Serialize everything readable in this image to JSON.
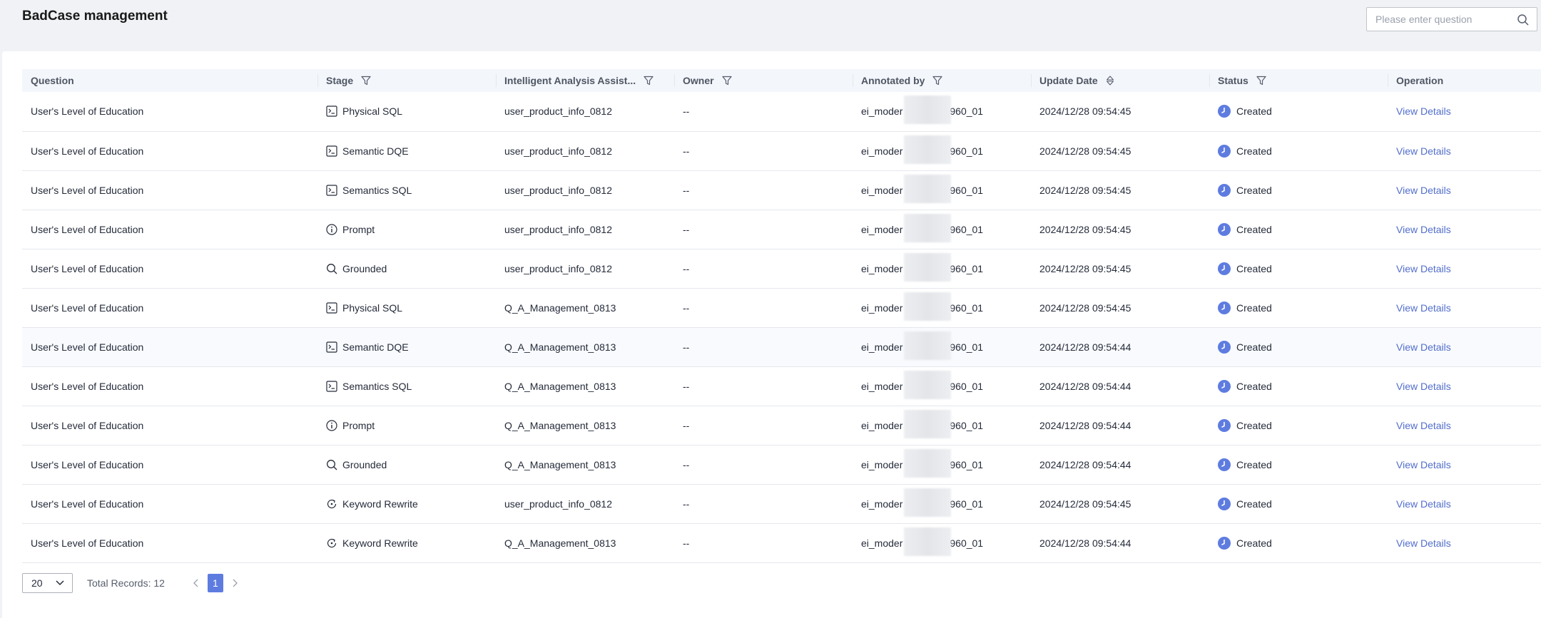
{
  "header": {
    "title": "BadCase management",
    "search_placeholder": "Please enter question"
  },
  "table": {
    "columns": [
      {
        "label": "Question",
        "filter": false,
        "sort": false
      },
      {
        "label": "Stage",
        "filter": true,
        "sort": false
      },
      {
        "label": "Intelligent Analysis Assist...",
        "filter": true,
        "sort": false
      },
      {
        "label": "Owner",
        "filter": true,
        "sort": false
      },
      {
        "label": "Annotated by",
        "filter": true,
        "sort": false
      },
      {
        "label": "Update Date",
        "filter": false,
        "sort": true
      },
      {
        "label": "Status",
        "filter": true,
        "sort": false
      },
      {
        "label": "Operation",
        "filter": false,
        "sort": false
      }
    ],
    "rows": [
      {
        "question": "User's Level of Education",
        "stage": "Physical SQL",
        "stage_icon": "sql-terminal-icon",
        "assistant": "user_product_info_0812",
        "owner": "--",
        "annotated_prefix": "ei_moder",
        "annotated_suffix": "960_01",
        "date": "2024/12/28 09:54:45",
        "status": "Created",
        "operation": "View Details"
      },
      {
        "question": "User's Level of Education",
        "stage": "Semantic DQE",
        "stage_icon": "sql-terminal-icon",
        "assistant": "user_product_info_0812",
        "owner": "--",
        "annotated_prefix": "ei_moder",
        "annotated_suffix": "960_01",
        "date": "2024/12/28 09:54:45",
        "status": "Created",
        "operation": "View Details"
      },
      {
        "question": "User's Level of Education",
        "stage": "Semantics SQL",
        "stage_icon": "sql-terminal-icon",
        "assistant": "user_product_info_0812",
        "owner": "--",
        "annotated_prefix": "ei_moder",
        "annotated_suffix": "960_01",
        "date": "2024/12/28 09:54:45",
        "status": "Created",
        "operation": "View Details"
      },
      {
        "question": "User's Level of Education",
        "stage": "Prompt",
        "stage_icon": "info-circle-icon",
        "assistant": "user_product_info_0812",
        "owner": "--",
        "annotated_prefix": "ei_moder",
        "annotated_suffix": "960_01",
        "date": "2024/12/28 09:54:45",
        "status": "Created",
        "operation": "View Details"
      },
      {
        "question": "User's Level of Education",
        "stage": "Grounded",
        "stage_icon": "search-icon",
        "assistant": "user_product_info_0812",
        "owner": "--",
        "annotated_prefix": "ei_moder",
        "annotated_suffix": "960_01",
        "date": "2024/12/28 09:54:45",
        "status": "Created",
        "operation": "View Details"
      },
      {
        "question": "User's Level of Education",
        "stage": "Physical SQL",
        "stage_icon": "sql-terminal-icon",
        "assistant": "Q_A_Management_0813",
        "owner": "--",
        "annotated_prefix": "ei_moder",
        "annotated_suffix": "960_01",
        "date": "2024/12/28 09:54:45",
        "status": "Created",
        "operation": "View Details"
      },
      {
        "question": "User's Level of Education",
        "stage": "Semantic DQE",
        "stage_icon": "sql-terminal-icon",
        "assistant": "Q_A_Management_0813",
        "owner": "--",
        "annotated_prefix": "ei_moder",
        "annotated_suffix": "960_01",
        "date": "2024/12/28 09:54:44",
        "status": "Created",
        "operation": "View Details"
      },
      {
        "question": "User's Level of Education",
        "stage": "Semantics SQL",
        "stage_icon": "sql-terminal-icon",
        "assistant": "Q_A_Management_0813",
        "owner": "--",
        "annotated_prefix": "ei_moder",
        "annotated_suffix": "960_01",
        "date": "2024/12/28 09:54:44",
        "status": "Created",
        "operation": "View Details"
      },
      {
        "question": "User's Level of Education",
        "stage": "Prompt",
        "stage_icon": "info-circle-icon",
        "assistant": "Q_A_Management_0813",
        "owner": "--",
        "annotated_prefix": "ei_moder",
        "annotated_suffix": "960_01",
        "date": "2024/12/28 09:54:44",
        "status": "Created",
        "operation": "View Details"
      },
      {
        "question": "User's Level of Education",
        "stage": "Grounded",
        "stage_icon": "search-icon",
        "assistant": "Q_A_Management_0813",
        "owner": "--",
        "annotated_prefix": "ei_moder",
        "annotated_suffix": "960_01",
        "date": "2024/12/28 09:54:44",
        "status": "Created",
        "operation": "View Details"
      },
      {
        "question": "User's Level of Education",
        "stage": "Keyword Rewrite",
        "stage_icon": "refresh-icon",
        "assistant": "user_product_info_0812",
        "owner": "--",
        "annotated_prefix": "ei_moder",
        "annotated_suffix": "960_01",
        "date": "2024/12/28 09:54:45",
        "status": "Created",
        "operation": "View Details"
      },
      {
        "question": "User's Level of Education",
        "stage": "Keyword Rewrite",
        "stage_icon": "refresh-icon",
        "assistant": "Q_A_Management_0813",
        "owner": "--",
        "annotated_prefix": "ei_moder",
        "annotated_suffix": "960_01",
        "date": "2024/12/28 09:54:44",
        "status": "Created",
        "operation": "View Details"
      }
    ]
  },
  "pagination": {
    "page_size": "20",
    "total_label": "Total Records: 12",
    "current_page": "1"
  },
  "colors": {
    "accent": "#5e7ce0",
    "link": "#526ecc",
    "header_bg": "#f3f6fb",
    "status_created": "#5e7ce0"
  }
}
